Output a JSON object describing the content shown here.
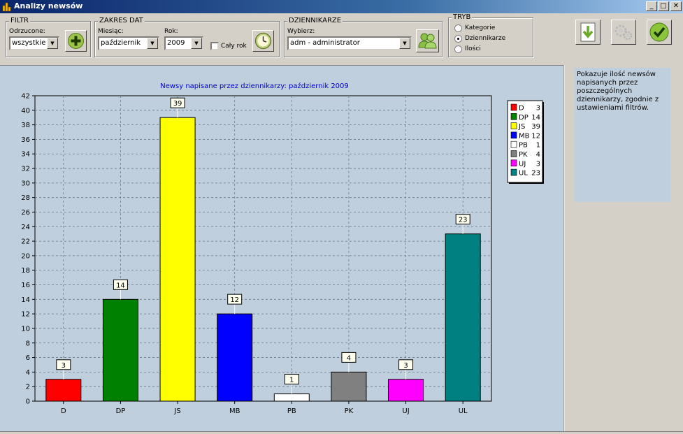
{
  "window": {
    "title": "Analizy newsów"
  },
  "filtr": {
    "group_title": "FILTR",
    "label": "Odrzucone:",
    "value": "wszystkie"
  },
  "zakres": {
    "group_title": "ZAKRES DAT",
    "month_label": "Miesiąc:",
    "month_value": "październik",
    "year_label": "Rok:",
    "year_value": "2009",
    "whole_year_label": "Cały rok"
  },
  "dziennikarze": {
    "group_title": "DZIENNIKARZE",
    "label": "Wybierz:",
    "value": "adm - administrator"
  },
  "tryb": {
    "group_title": "TRYB",
    "options": [
      "Kategorie",
      "Dziennikarze",
      "Ilości"
    ],
    "selected": 1
  },
  "info_text": "Pokazuje ilość newsów napisanych przez poszczególnych dziennikarzy, zgodnie z ustawieniami filtrów.",
  "chart_data": {
    "type": "bar",
    "title": "Newsy napisane przez dziennikarzy: październik 2009",
    "categories": [
      "D",
      "DP",
      "JS",
      "MB",
      "PB",
      "PK",
      "UJ",
      "UL"
    ],
    "values": [
      3,
      14,
      39,
      12,
      1,
      4,
      3,
      23
    ],
    "colors": [
      "#ff0000",
      "#008000",
      "#ffff00",
      "#0000ff",
      "#ffffff",
      "#808080",
      "#ff00ff",
      "#008080"
    ],
    "ylim": [
      0,
      42
    ],
    "yticks": [
      0,
      2,
      4,
      6,
      8,
      10,
      12,
      14,
      16,
      18,
      20,
      22,
      24,
      26,
      28,
      30,
      32,
      34,
      36,
      38,
      40,
      42
    ],
    "grid": true,
    "legend_position": "top-right"
  }
}
